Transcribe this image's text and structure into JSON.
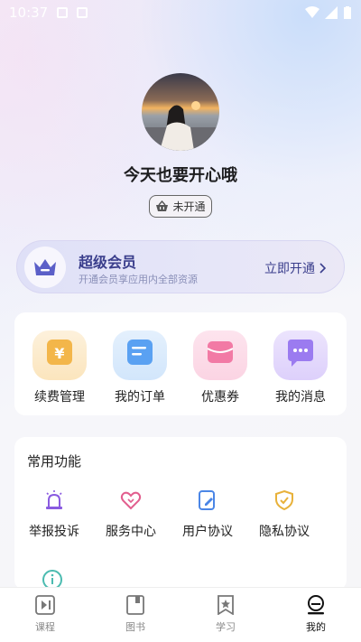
{
  "status_bar": {
    "time": "10:37"
  },
  "profile": {
    "username": "今天也要开心哦",
    "vip_status": "未开通"
  },
  "member_card": {
    "title": "超级会员",
    "subtitle": "开通会员享应用内全部资源",
    "cta": "立即开通"
  },
  "quick_actions": [
    {
      "label": "续费管理",
      "icon": "yen-icon",
      "color": "#f3b64a"
    },
    {
      "label": "我的订单",
      "icon": "order-icon",
      "color": "#5aa1f2"
    },
    {
      "label": "优惠券",
      "icon": "coupon-icon",
      "color": "#f27aa5"
    },
    {
      "label": "我的消息",
      "icon": "message-icon",
      "color": "#9b7bf0"
    }
  ],
  "common": {
    "title": "常用功能",
    "items": [
      {
        "label": "举报投诉",
        "icon": "alarm-icon",
        "color": "#8a5be0"
      },
      {
        "label": "服务中心",
        "icon": "heart-icon",
        "color": "#e25e8e"
      },
      {
        "label": "用户协议",
        "icon": "document-edit-icon",
        "color": "#4b86e6"
      },
      {
        "label": "隐私协议",
        "icon": "shield-check-icon",
        "color": "#e8b13a"
      }
    ]
  },
  "bottom_nav": {
    "items": [
      {
        "label": "课程",
        "icon": "course-icon"
      },
      {
        "label": "图书",
        "icon": "book-icon"
      },
      {
        "label": "学习",
        "icon": "study-icon"
      },
      {
        "label": "我的",
        "icon": "profile-icon",
        "active": true
      }
    ]
  }
}
